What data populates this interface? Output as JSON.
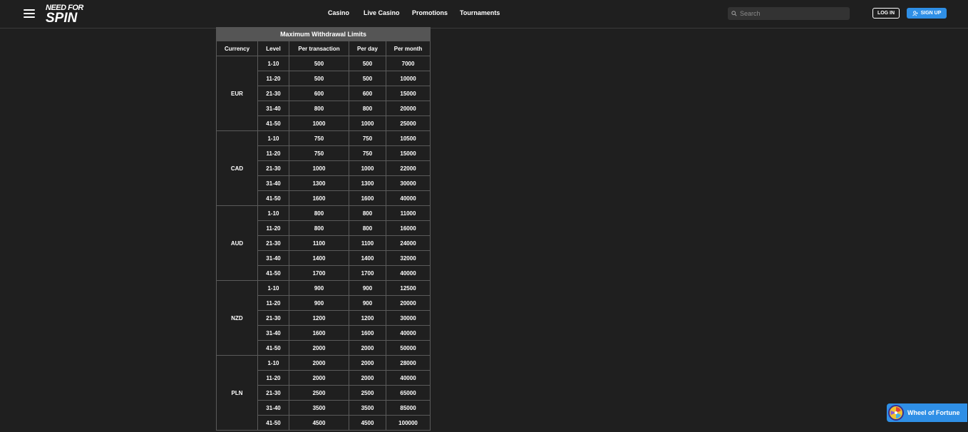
{
  "header": {
    "logo_line1": "NEED FOR",
    "logo_line2": "SPIN",
    "nav": [
      "Casino",
      "Live Casino",
      "Promotions",
      "Tournaments"
    ],
    "search_placeholder": "Search",
    "login_label": "LOG IN",
    "signup_label": "SIGN UP"
  },
  "table": {
    "caption": "Maximum Withdrawal Limits",
    "columns": [
      "Currency",
      "Level",
      "Per transaction",
      "Per day",
      "Per month"
    ],
    "groups": [
      {
        "currency": "EUR",
        "rows": [
          [
            "1-10",
            "500",
            "500",
            "7000"
          ],
          [
            "11-20",
            "500",
            "500",
            "10000"
          ],
          [
            "21-30",
            "600",
            "600",
            "15000"
          ],
          [
            "31-40",
            "800",
            "800",
            "20000"
          ],
          [
            "41-50",
            "1000",
            "1000",
            "25000"
          ]
        ]
      },
      {
        "currency": "CAD",
        "rows": [
          [
            "1-10",
            "750",
            "750",
            "10500"
          ],
          [
            "11-20",
            "750",
            "750",
            "15000"
          ],
          [
            "21-30",
            "1000",
            "1000",
            "22000"
          ],
          [
            "31-40",
            "1300",
            "1300",
            "30000"
          ],
          [
            "41-50",
            "1600",
            "1600",
            "40000"
          ]
        ]
      },
      {
        "currency": "AUD",
        "rows": [
          [
            "1-10",
            "800",
            "800",
            "11000"
          ],
          [
            "11-20",
            "800",
            "800",
            "16000"
          ],
          [
            "21-30",
            "1100",
            "1100",
            "24000"
          ],
          [
            "31-40",
            "1400",
            "1400",
            "32000"
          ],
          [
            "41-50",
            "1700",
            "1700",
            "40000"
          ]
        ]
      },
      {
        "currency": "NZD",
        "rows": [
          [
            "1-10",
            "900",
            "900",
            "12500"
          ],
          [
            "11-20",
            "900",
            "900",
            "20000"
          ],
          [
            "21-30",
            "1200",
            "1200",
            "30000"
          ],
          [
            "31-40",
            "1600",
            "1600",
            "40000"
          ],
          [
            "41-50",
            "2000",
            "2000",
            "50000"
          ]
        ]
      },
      {
        "currency": "PLN",
        "rows": [
          [
            "1-10",
            "2000",
            "2000",
            "28000"
          ],
          [
            "11-20",
            "2000",
            "2000",
            "40000"
          ],
          [
            "21-30",
            "2500",
            "2500",
            "65000"
          ],
          [
            "31-40",
            "3500",
            "3500",
            "85000"
          ],
          [
            "41-50",
            "4500",
            "4500",
            "100000"
          ]
        ]
      }
    ]
  },
  "widget": {
    "wheel_label": "Wheel of Fortune"
  },
  "colors": {
    "background": "#1f1f1f",
    "accent": "#2f8fe6",
    "caption_bg": "#555555",
    "border": "#5a5a5a"
  },
  "icons": [
    "menu-icon",
    "search-icon",
    "user-plus-icon",
    "wheel-of-fortune-icon"
  ]
}
